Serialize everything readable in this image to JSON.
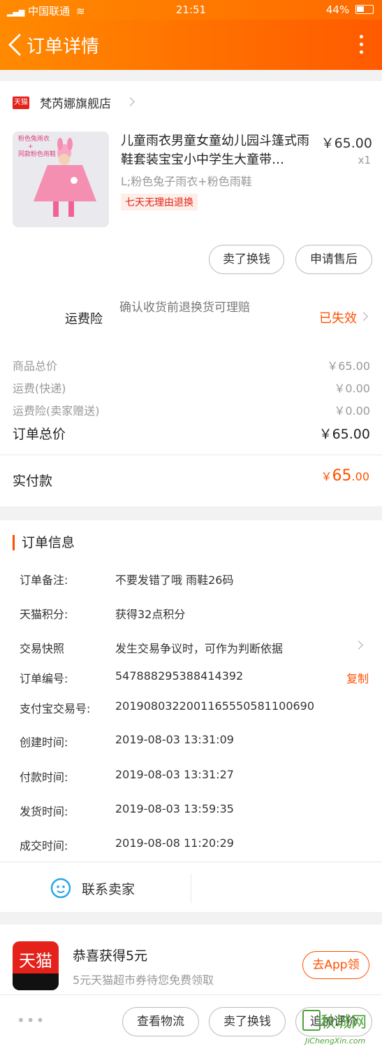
{
  "status_bar": {
    "carrier": "中国联通",
    "time": "21:51",
    "battery": "44%"
  },
  "nav": {
    "title": "订单详情"
  },
  "shop": {
    "badge": "天猫",
    "name": "梵芮娜旗舰店"
  },
  "product": {
    "thumb_text_1": "粉色兔雨衣",
    "thumb_text_2": "+",
    "thumb_text_3": "同款粉色雨鞋",
    "title": "儿童雨衣男童女童幼儿园斗篷式雨鞋套装宝宝小中学生大童带…",
    "price": "￥65.00",
    "qty": "x1",
    "sku": "L;粉色兔子雨衣+粉色雨鞋",
    "tag": "七天无理由退换"
  },
  "actions": {
    "sell": "卖了换钱",
    "aftersale": "申请售后"
  },
  "insurance": {
    "label": "运费险",
    "desc": "确认收货前退换货可理赔",
    "status": "已失效"
  },
  "fees": [
    {
      "k": "商品总价",
      "v": "￥65.00"
    },
    {
      "k": "运费(快递)",
      "v": "￥0.00"
    },
    {
      "k": "运费险(卖家赠送)",
      "v": "￥0.00"
    }
  ],
  "order_total": {
    "k": "订单总价",
    "v": "￥65.00"
  },
  "paid": {
    "k": "实付款",
    "currency": "￥",
    "int": "65",
    "dec": ".00"
  },
  "info": {
    "title": "订单信息",
    "rows": [
      {
        "k": "订单备注:",
        "v": "不要发错了哦  雨鞋26码"
      },
      {
        "k": "天猫积分:",
        "v": "获得32点积分"
      },
      {
        "k": "交易快照",
        "v": "发生交易争议时，可作为判断依据"
      },
      {
        "k": "订单编号:",
        "v": "547888295388414392"
      },
      {
        "k": "支付宝交易号:",
        "v": "2019080322001165550581100690"
      },
      {
        "k": "创建时间:",
        "v": "2019-08-03 13:31:09"
      },
      {
        "k": "付款时间:",
        "v": "2019-08-03 13:31:27"
      },
      {
        "k": "发货时间:",
        "v": "2019-08-03 13:59:35"
      },
      {
        "k": "成交时间:",
        "v": "2019-08-08 11:20:29"
      }
    ],
    "copy": "复制",
    "contact": "联系卖家"
  },
  "promo": {
    "logo": "天猫",
    "title": "恭喜获得5元",
    "sub": "5元天猫超市券待您免费领取",
    "button": "去App领"
  },
  "bottom": {
    "more": "•••",
    "logistics": "查看物流",
    "sell": "卖了换钱",
    "review": "追加评价"
  },
  "watermark": {
    "text": "秋城网",
    "url": "JiChengXin.com"
  },
  "colors": {
    "accent": "#ff5000",
    "nav_start": "#ff8a00",
    "nav_end": "#ff5a00",
    "tmall_red": "#e4211a"
  }
}
